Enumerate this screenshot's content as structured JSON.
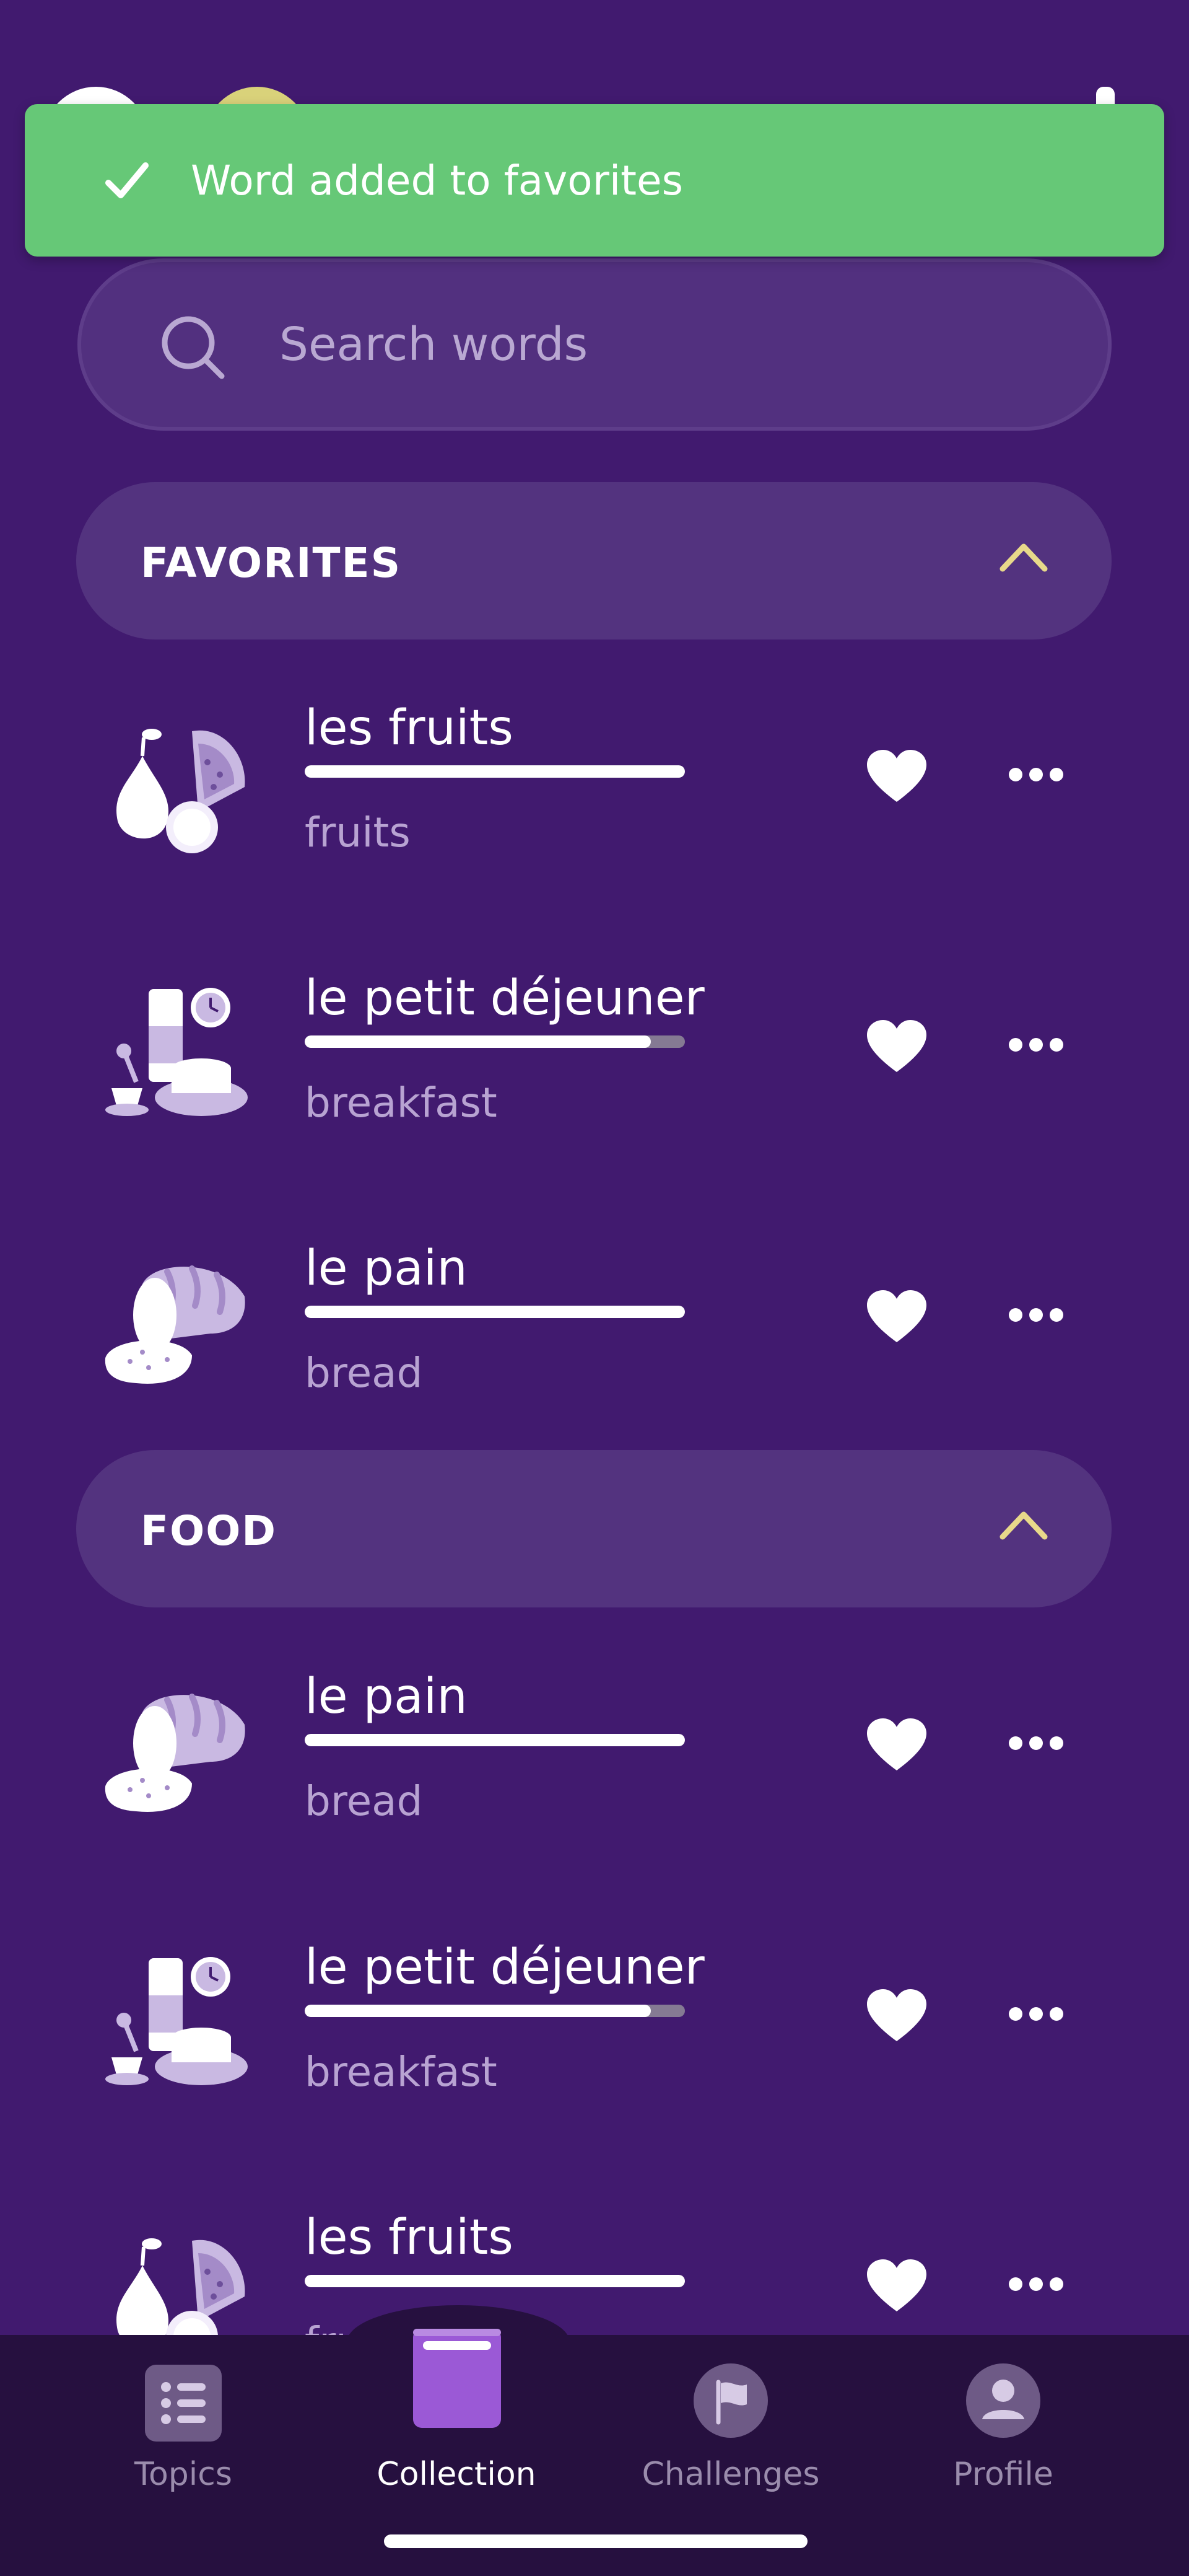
{
  "toast": {
    "message": "Word added to favorites"
  },
  "search": {
    "placeholder": "Search words"
  },
  "sections": [
    {
      "title": "FAVORITES",
      "items": [
        {
          "word": "les fruits",
          "translation": "fruits",
          "progress": 1.0,
          "icon": "fruits-icon",
          "favorite": true
        },
        {
          "word": "le petit déjeuner",
          "translation": "breakfast",
          "progress": 0.91,
          "icon": "breakfast-icon",
          "favorite": true
        },
        {
          "word": "le pain",
          "translation": "bread",
          "progress": 1.0,
          "icon": "bread-icon",
          "favorite": true
        }
      ]
    },
    {
      "title": "FOOD",
      "items": [
        {
          "word": "le pain",
          "translation": "bread",
          "progress": 1.0,
          "icon": "bread-icon",
          "favorite": true
        },
        {
          "word": "le petit déjeuner",
          "translation": "breakfast",
          "progress": 0.91,
          "icon": "breakfast-icon",
          "favorite": true
        },
        {
          "word": "les fruits",
          "translation": "fruits",
          "progress": 1.0,
          "icon": "fruits-icon",
          "favorite": true
        }
      ]
    }
  ],
  "nav": {
    "items": [
      {
        "label": "Topics",
        "icon": "list-icon",
        "active": false
      },
      {
        "label": "Collection",
        "icon": "book-icon",
        "active": true
      },
      {
        "label": "Challenges",
        "icon": "flag-icon",
        "active": false
      },
      {
        "label": "Profile",
        "icon": "person-icon",
        "active": false
      }
    ]
  },
  "colors": {
    "background": "#411a6f",
    "toast": "#66c877",
    "section_header": "#53337f",
    "chevron": "#e8d98a",
    "nav_background": "#26103f",
    "nav_active": "#9b59d6"
  }
}
